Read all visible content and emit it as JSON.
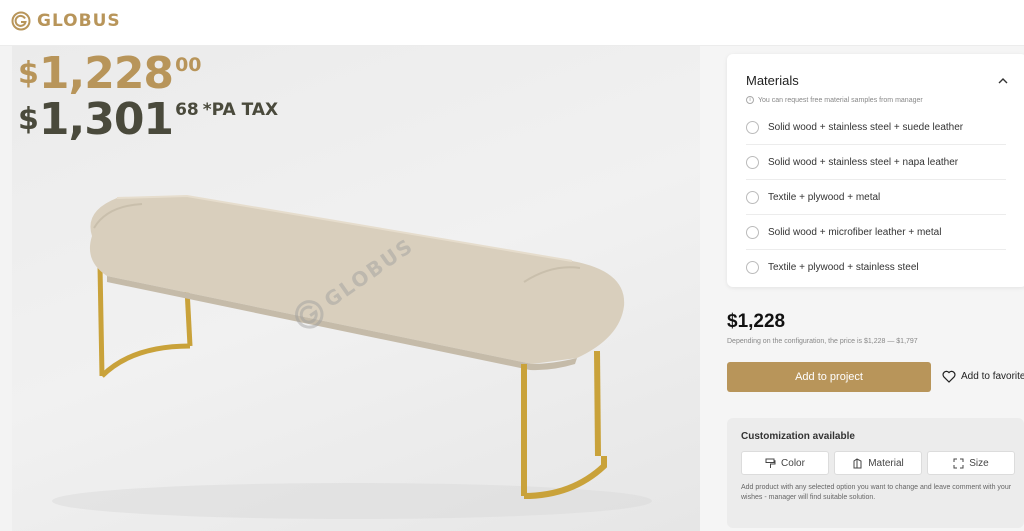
{
  "header": {
    "brand": "GLOBUS"
  },
  "hero": {
    "price_main": {
      "currency": "$",
      "integer": "1,228",
      "decimals": "00"
    },
    "price_tax": {
      "currency": "$",
      "integer": "1,301",
      "decimals": "68",
      "tax_label": "*PA TAX"
    },
    "watermark": "GLOBUS"
  },
  "materials": {
    "title": "Materials",
    "info": "You can request free material samples from manager",
    "options": [
      {
        "label": "Solid wood + stainless steel + suede leather"
      },
      {
        "label": "Solid wood + stainless steel + napa leather"
      },
      {
        "label": "Textile + plywood + metal"
      },
      {
        "label": "Solid wood + microfiber leather + metal"
      },
      {
        "label": "Textile + plywood + stainless steel"
      }
    ]
  },
  "pricing": {
    "price": "$1,228",
    "range_note": "Depending on the configuration, the price is $1,228 — $1,797"
  },
  "actions": {
    "add_to_project": "Add to project",
    "add_to_favorites": "Add to favorite"
  },
  "customization": {
    "title": "Customization available",
    "buttons": [
      {
        "label": "Color",
        "icon": "paint-roller-icon"
      },
      {
        "label": "Material",
        "icon": "material-icon"
      },
      {
        "label": "Size",
        "icon": "resize-icon"
      }
    ],
    "note": "Add product with any selected option you want to change and leave comment with your wishes - manager will find suitable solution."
  },
  "colors": {
    "accent": "#b8955a",
    "dark_price": "#4a4a3c",
    "fabric": "#d9cfbd",
    "legs": "#c9a23a"
  }
}
